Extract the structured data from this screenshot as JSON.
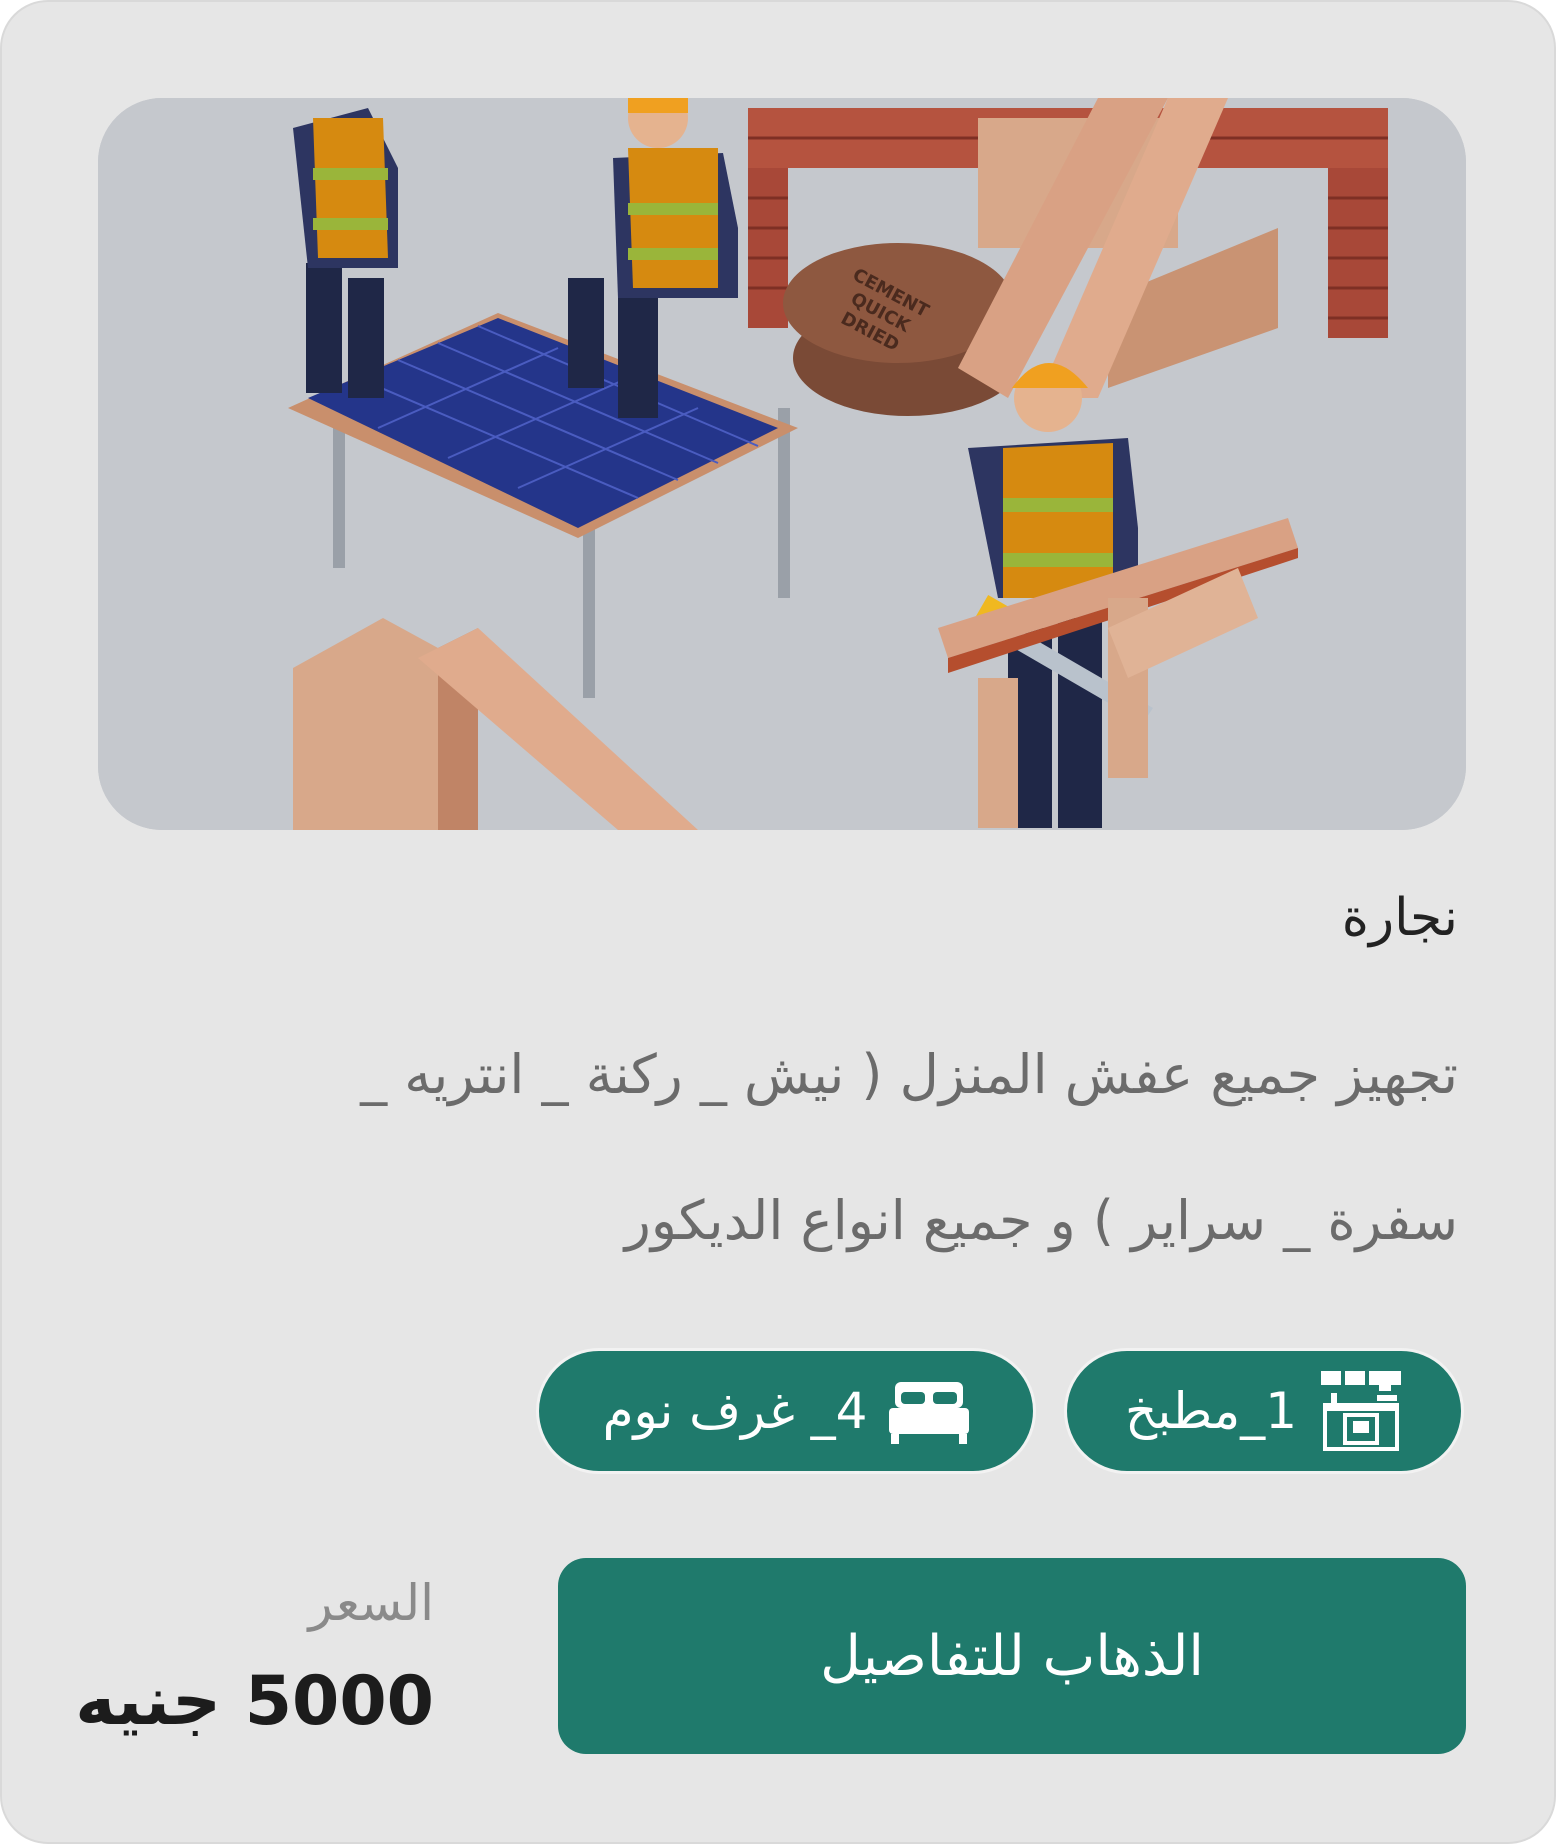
{
  "listing": {
    "image_alt": "carpentry workers illustration",
    "title": "نجارة",
    "description": "تجهيز جميع عفش المنزل ( نيش _ ركنة _ انتريه _ سفرة _ سراير ) و جميع انواع الديكور",
    "features": {
      "kitchen": {
        "label": "1_مطبخ",
        "icon": "kitchen-icon"
      },
      "bedrooms": {
        "label": "4_ غرف نوم",
        "icon": "bed-icon"
      }
    },
    "details_button": "الذهاب للتفاصيل",
    "price_label": "السعر",
    "price_value": "5000 جنيه",
    "cement_bag_text": "CEMENT QUICK DRIED"
  },
  "colors": {
    "accent": "#1f7a6c",
    "card_bg": "#e6e6e6",
    "hero_bg": "#c5c8cd"
  }
}
